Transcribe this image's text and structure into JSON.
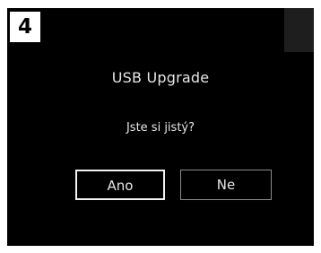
{
  "step": {
    "number": "4"
  },
  "dialog": {
    "title": "USB Upgrade",
    "question": "Jste si jistý?",
    "buttons": {
      "yes_label": "Ano",
      "no_label": "Ne"
    }
  },
  "colors": {
    "screen_background": "#000000",
    "text": "#e6e6e6",
    "badge_background": "#ffffff",
    "focused_button_border": "#f2f2f2",
    "button_border": "#8c8c8c"
  }
}
